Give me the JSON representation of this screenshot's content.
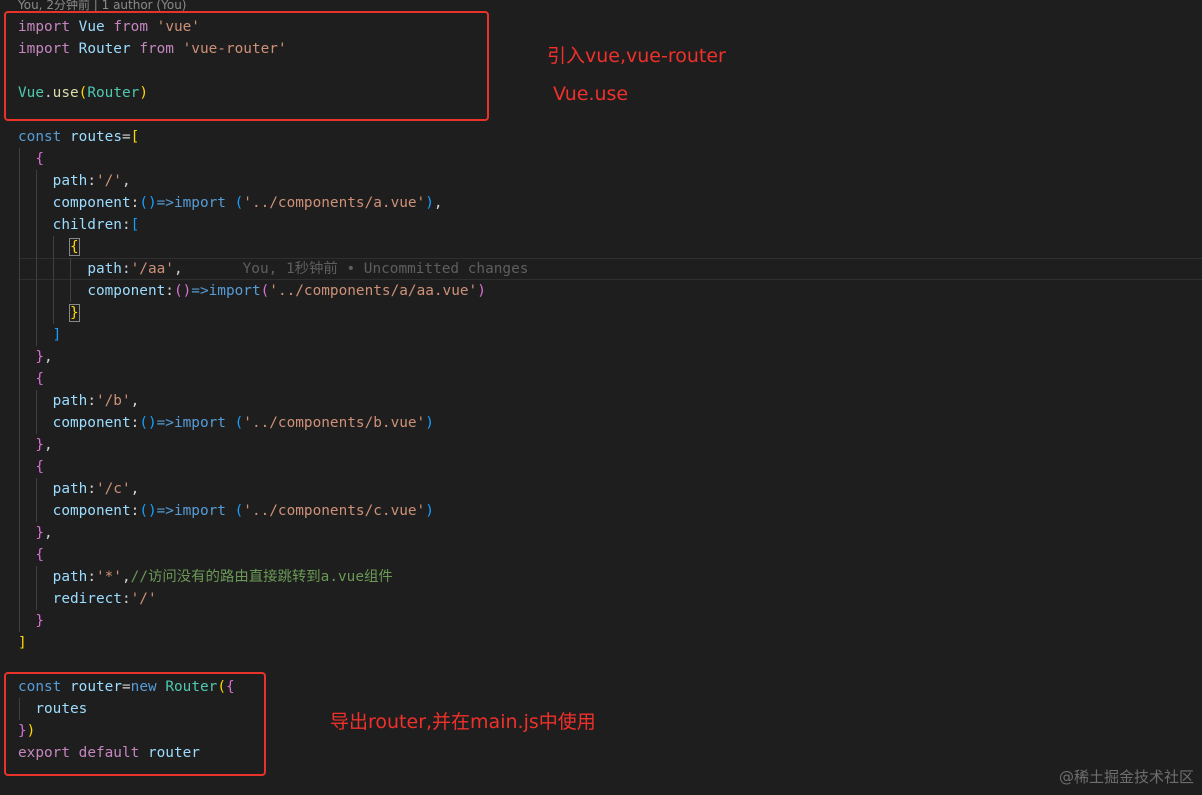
{
  "codelens": "You, 2分钟前 | 1 author (You)",
  "code": {
    "l1": {
      "kw": "import",
      "name": "Vue",
      "from": "from",
      "str": "'vue'"
    },
    "l2": {
      "kw": "import",
      "name": "Router",
      "from": "from",
      "str": "'vue-router'"
    },
    "l4": {
      "obj": "Vue",
      "dot": ".",
      "fn": "use",
      "open": "(",
      "arg": "Router",
      "close": ")"
    },
    "l6": {
      "kw": "const",
      "name": "routes",
      "eq": "=",
      "br": "["
    },
    "l7": {
      "br": "{"
    },
    "l8": {
      "key": "path",
      "colon": ":",
      "str": "'/'",
      "tail": ","
    },
    "l9": {
      "key": "component",
      "colon": ":",
      "paren": "()",
      "arrow": "=>",
      "fn": "import",
      "open": " (",
      "str": "'../components/a.vue'",
      "close": ")",
      "tail": ","
    },
    "l10": {
      "key": "children",
      "colon": ":",
      "br": "["
    },
    "l11": {
      "br": "{"
    },
    "l12": {
      "key": "path",
      "colon": ":",
      "str": "'/aa'",
      "tail": ",",
      "blame": "You, 1秒钟前 • Uncommitted changes"
    },
    "l13": {
      "key": "component",
      "colon": ":",
      "paren": "()",
      "arrow": "=>",
      "fn": "import",
      "open": "(",
      "str": "'../components/a/aa.vue'",
      "close": ")"
    },
    "l14": {
      "br": "}"
    },
    "l15": {
      "br": "]"
    },
    "l16": {
      "br": "}",
      "tail": ","
    },
    "l17": {
      "br": "{"
    },
    "l18": {
      "key": "path",
      "colon": ":",
      "str": "'/b'",
      "tail": ","
    },
    "l19": {
      "key": "component",
      "colon": ":",
      "paren": "()",
      "arrow": "=>",
      "fn": "import",
      "open": " (",
      "str": "'../components/b.vue'",
      "close": ")"
    },
    "l20": {
      "br": "}",
      "tail": ","
    },
    "l21": {
      "br": "{"
    },
    "l22": {
      "key": "path",
      "colon": ":",
      "str": "'/c'",
      "tail": ","
    },
    "l23": {
      "key": "component",
      "colon": ":",
      "paren": "()",
      "arrow": "=>",
      "fn": "import",
      "open": " (",
      "str": "'../components/c.vue'",
      "close": ")"
    },
    "l24": {
      "br": "}",
      "tail": ","
    },
    "l25": {
      "br": "{"
    },
    "l26": {
      "key": "path",
      "colon": ":",
      "str": "'*'",
      "tail": ",",
      "cmt": "//访问没有的路由直接跳转到a.vue组件"
    },
    "l27": {
      "key": "redirect",
      "colon": ":",
      "str": "'/'"
    },
    "l28": {
      "br": "}"
    },
    "l29": {
      "br": "]"
    },
    "l31": {
      "kw": "const",
      "name": "router",
      "eq": "=",
      "nw": "new",
      "cls": "Router",
      "open": "(",
      "br": "{"
    },
    "l32": {
      "name": "routes"
    },
    "l33": {
      "br": "}",
      "close": ")"
    },
    "l34": {
      "kw": "export",
      "dflt": "default",
      "name": "router"
    }
  },
  "annotations": {
    "a1": "引入vue,vue-router",
    "a2": "Vue.use",
    "a3": "导出router,并在main.js中使用"
  },
  "watermark": "@稀土掘金技术社区",
  "colors": {
    "background": "#1e1e1e",
    "annotation_red": "#e8332a",
    "keyword": "#569cd6",
    "control": "#c586c0",
    "string": "#ce9178",
    "variable": "#9cdcfe",
    "function": "#dcdcaa",
    "class": "#4ec9b0",
    "comment": "#6a9955"
  }
}
